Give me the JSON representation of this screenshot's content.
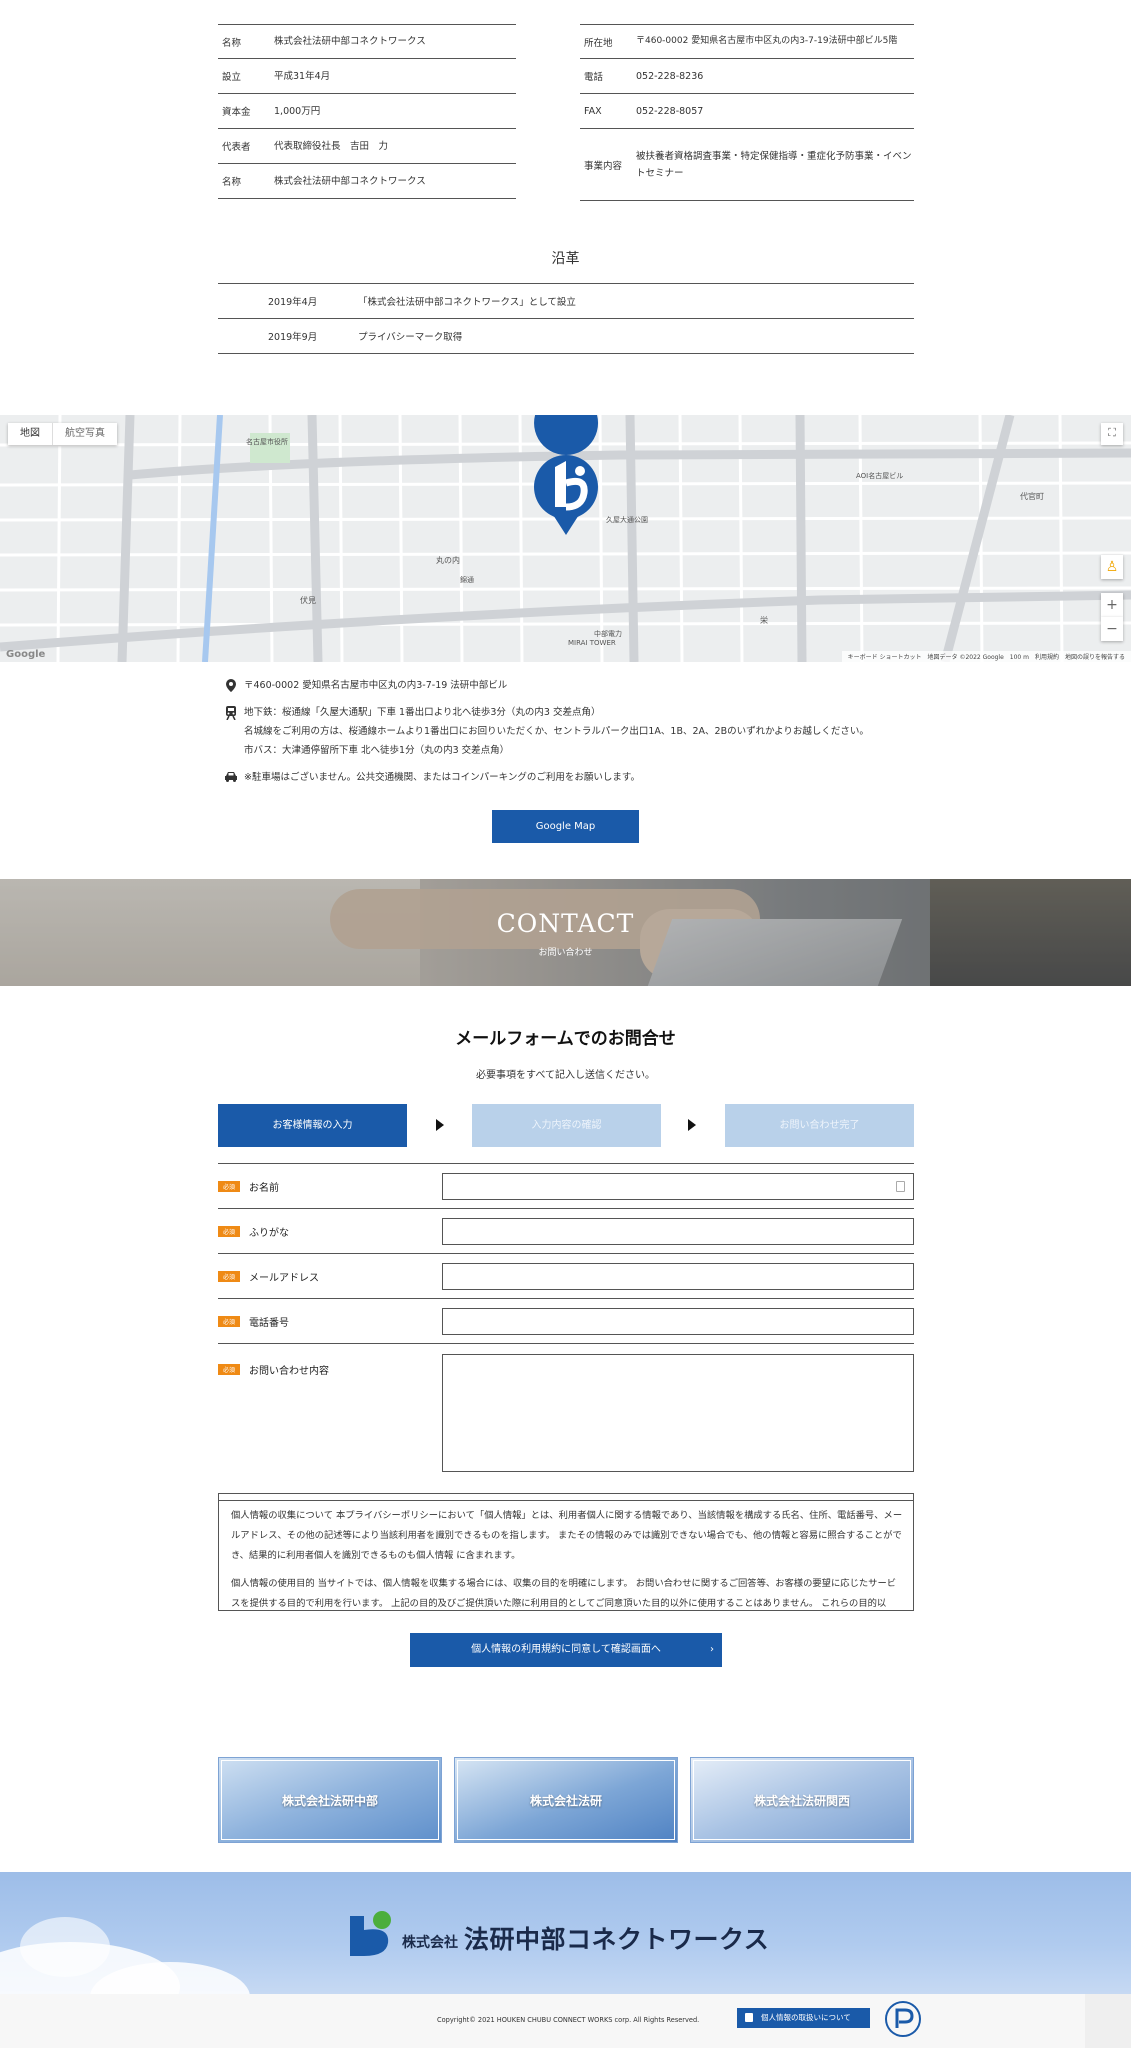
{
  "company_left": [
    {
      "key": "名称",
      "value": "株式会社法研中部コネクトワークス"
    },
    {
      "key": "設立",
      "value": "平成31年4月"
    },
    {
      "key": "資本金",
      "value": "1,000万円"
    },
    {
      "key": "代表者",
      "value": "代表取締役社長　吉田　力"
    },
    {
      "key": "名称",
      "value": "株式会社法研中部コネクトワークス"
    }
  ],
  "company_right": [
    {
      "key": "所在地",
      "value": "〒460-0002 愛知県名古屋市中区丸の内3-7-19法研中部ビル5階"
    },
    {
      "key": "電話",
      "value": "052-228-8236"
    },
    {
      "key": "FAX",
      "value": "052-228-8057"
    },
    {
      "key": "事業内容",
      "value": "被扶養者資格調査事業・特定保健指導・重症化予防事業・イベントセミナー"
    }
  ],
  "history": {
    "title": "沿革",
    "rows": [
      {
        "date": "2019年4月",
        "text": "「株式会社法研中部コネクトワークス」として設立"
      },
      {
        "date": "2019年9月",
        "text": "プライバシーマーク取得"
      }
    ]
  },
  "map": {
    "tab_map": "地図",
    "tab_satellite": "航空写真",
    "zoom_in": "+",
    "zoom_out": "−",
    "google": "Google",
    "footer": "キーボード ショートカット　地図データ ©2022 Google　100 m　利用規約　地図の誤りを報告する",
    "labels": {
      "marunouchi": "丸の内",
      "hisaya": "久屋大通公園",
      "mirai": "MIRAI TOWER",
      "aoi": "AOI名古屋ビル",
      "yotsuya": "代官町",
      "shiyakusho": "名古屋市役所",
      "tower": "中部電力",
      "fushimi": "伏見",
      "nishiki": "錦通",
      "sakae": "栄"
    }
  },
  "access": {
    "address": "〒460-0002 愛知県名古屋市中区丸の内3-7-19 法研中部ビル",
    "train_1": "地下鉄：桜通線「久屋大通駅」下車 1番出口より北へ徒歩3分（丸の内3 交差点角）",
    "train_2": "名城線をご利用の方は、桜通線ホームより1番出口にお回りいただくか、セントラルパーク出口1A、1B、2A、2Bのいずれかよりお越しください。",
    "train_3": "市バス：大津通停留所下車 北へ徒歩1分（丸の内3 交差点角）",
    "car": "※駐車場はございません。公共交通機関、またはコインパーキングのご利用をお願いします。",
    "button": "Google Map"
  },
  "banner": {
    "title": "CONTACT",
    "subtitle": "お問い合わせ"
  },
  "form": {
    "title": "メールフォームでのお問合せ",
    "lead": "必要事項をすべて記入し送信ください。",
    "steps": [
      "お客様情報の入力",
      "入力内容の確認",
      "お問い合わせ完了"
    ],
    "required": "必須",
    "fields": [
      "お名前",
      "ふりがな",
      "メールアドレス",
      "電話番号",
      "お問い合わせ内容"
    ],
    "policy_1": "個人情報の収集について 本プライバシーポリシーにおいて「個人情報」とは、利用者個人に関する情報であり、当該情報を構成する氏名、住所、電話番号、メールアドレス、その他の記述等により当該利用者を識別できるものを指します。 またその情報のみでは識別できない場合でも、他の情報と容易に照合することができ、結果的に利用者個人を識別できるものも個人情報 に含まれます。",
    "policy_2": "個人情報の使用目的 当サイトでは、個人情報を収集する場合には、収集の目的を明確にします。 お問い合わせに関するご回答等、お客様の要望に応じたサービスを提供する目的で利用を行います。 上記の目的及びご提供頂いた際に利用目的としてご同意頂いた目的以外に使用することはありません。 これらの目的以",
    "confirm": "個人情報の利用規約に同意して確認画面へ",
    "chevron": "›"
  },
  "groups": [
    "株式会社法研中部",
    "株式会社法研",
    "株式会社法研関西"
  ],
  "footer": {
    "logo_small": "株式会社",
    "logo_big": "法研中部コネクトワークス",
    "copyright": "Copyright© 2021 HOUKEN CHUBU CONNECT WORKS corp. All Rights Reserved.",
    "privacy": "個人情報の取扱いについて"
  },
  "colors": {
    "primary": "#1a5aa9",
    "step_inactive": "#b9d1ea",
    "required": "#ef8a15",
    "footer_sky": "#9dbde8"
  }
}
